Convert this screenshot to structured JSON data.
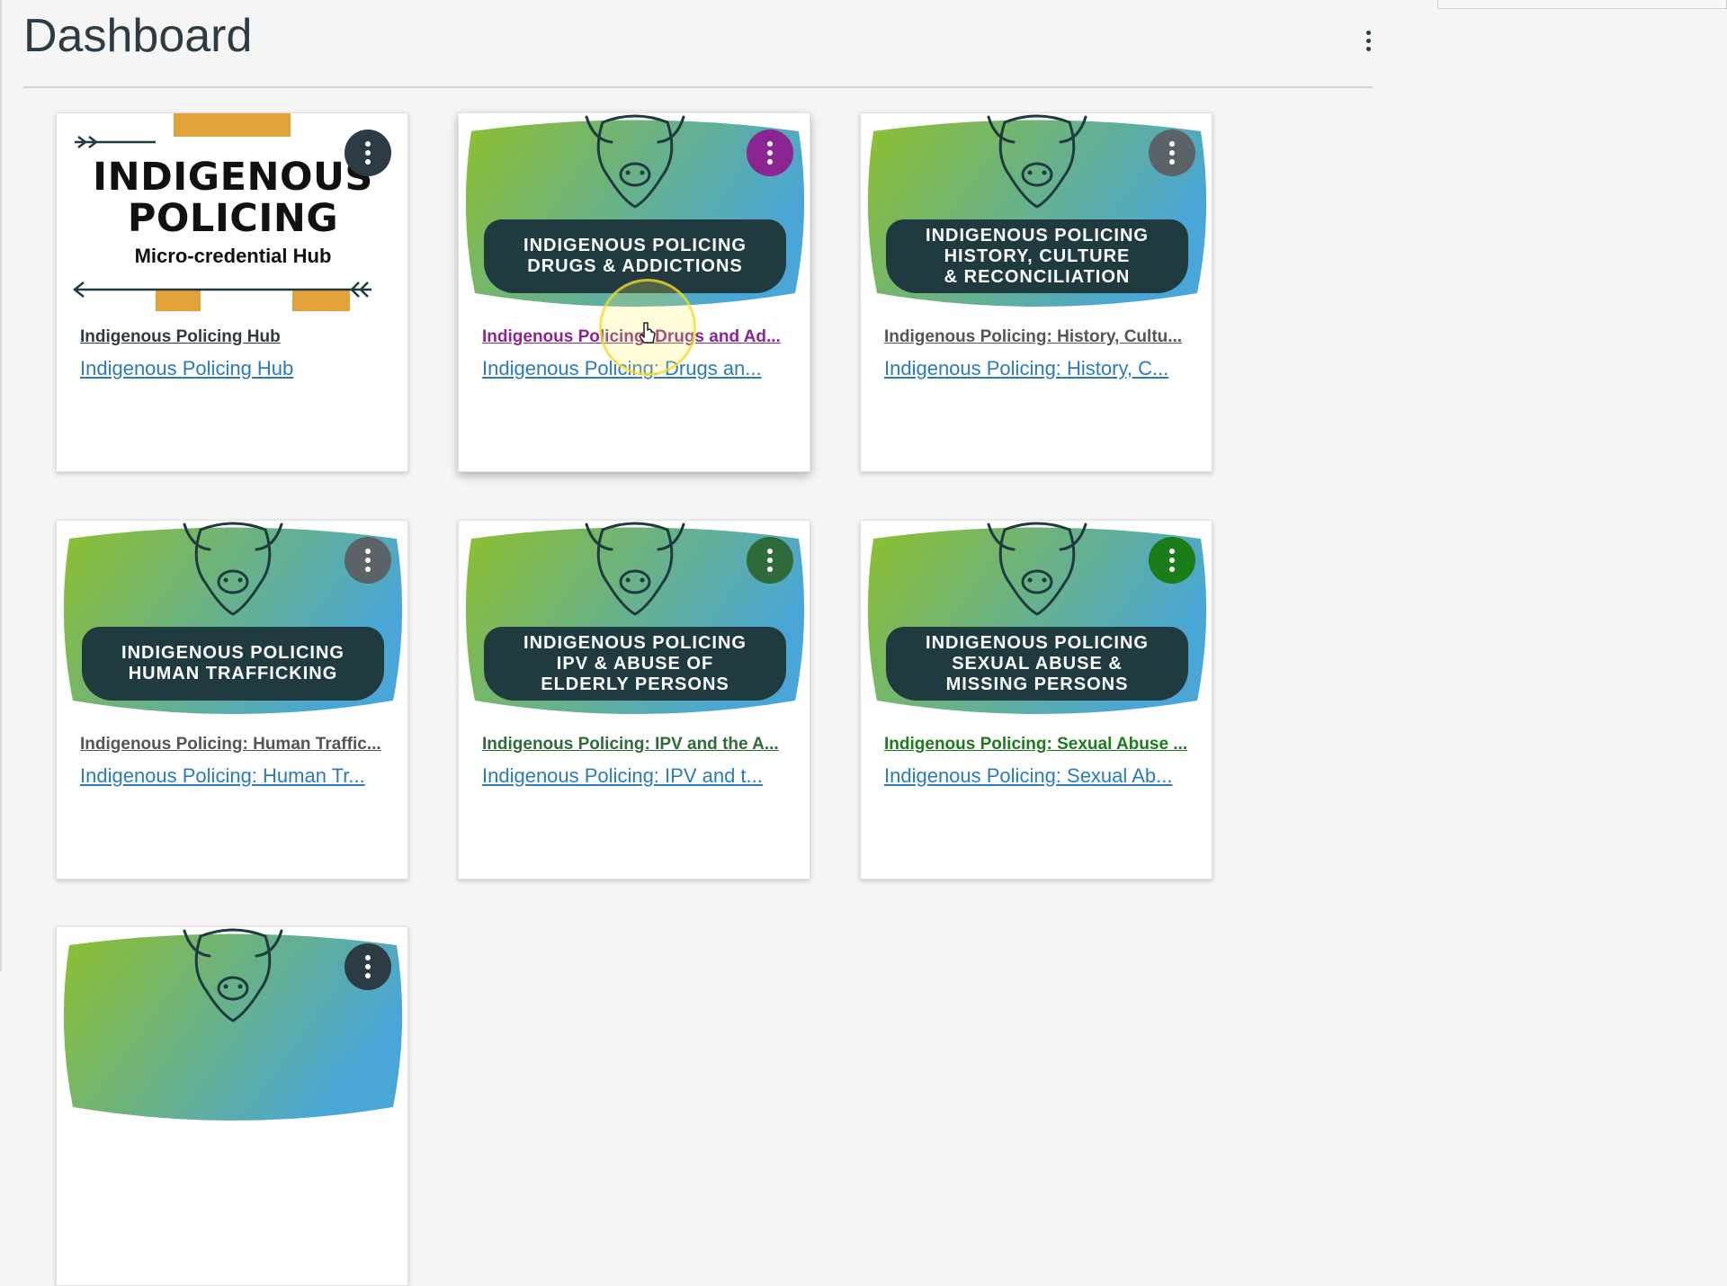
{
  "page": {
    "title": "Dashboard",
    "menu_icon": "vertical-ellipsis-icon"
  },
  "cards": [
    {
      "hero_type": "hub",
      "hero_lines": [
        "INDIGENOUS",
        "POLICING"
      ],
      "hero_sub": "Micro-credential Hub",
      "course_title": "Indigenous Policing Hub",
      "course_subtitle": "Indigenous Policing Hub",
      "accent_color": "#2d3b45",
      "menu_color": "#2d3b45"
    },
    {
      "hero_type": "banner",
      "hero_lines": [
        "INDIGENOUS POLICING",
        "DRUGS & ADDICTIONS"
      ],
      "course_title": "Indigenous Policing: Drugs and Ad...",
      "course_subtitle": "Indigenous Policing: Drugs an...",
      "accent_color": "#8b2591",
      "menu_color": "#8b2591"
    },
    {
      "hero_type": "banner",
      "hero_lines": [
        "INDIGENOUS POLICING",
        "HISTORY, CULTURE",
        "& RECONCILIATION"
      ],
      "course_title": "Indigenous Policing: History, Cultu...",
      "course_subtitle": "Indigenous Policing: History, C...",
      "accent_color": "#555555",
      "menu_color": "#5b6369"
    },
    {
      "hero_type": "banner",
      "hero_lines": [
        "INDIGENOUS POLICING",
        "HUMAN TRAFFICKING"
      ],
      "course_title": "Indigenous Policing: Human Traffic...",
      "course_subtitle": "Indigenous Policing: Human Tr...",
      "accent_color": "#555555",
      "menu_color": "#5b6369"
    },
    {
      "hero_type": "banner",
      "hero_lines": [
        "INDIGENOUS POLICING",
        "IPV & ABUSE OF",
        "ELDERLY PERSONS"
      ],
      "course_title": "Indigenous Policing: IPV and the A...",
      "course_subtitle": "Indigenous Policing: IPV and t...",
      "accent_color": "#2f6b3a",
      "menu_color": "#2f6b3a"
    },
    {
      "hero_type": "banner",
      "hero_lines": [
        "INDIGENOUS POLICING",
        "SEXUAL ABUSE &",
        "MISSING PERSONS"
      ],
      "course_title": "Indigenous Policing: Sexual Abuse ...",
      "course_subtitle": "Indigenous Policing: Sexual Ab...",
      "accent_color": "#1e7a1e",
      "menu_color": "#1a7d1a"
    },
    {
      "hero_type": "banner",
      "hero_lines": [],
      "course_title": "",
      "course_subtitle": "",
      "accent_color": "#2d3b45",
      "menu_color": "#2d3b45"
    }
  ],
  "colors": {
    "link": "#2b7abc",
    "gradient_green": "#8dbf2e",
    "gradient_blue": "#49a6d6",
    "banner_dark": "#1f3b40",
    "hub_orange": "#e2a33a"
  }
}
